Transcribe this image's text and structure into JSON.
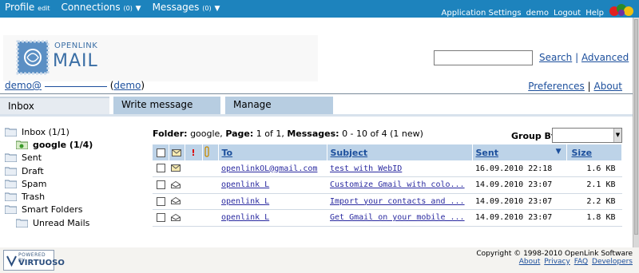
{
  "topbar": {
    "profile": "Profile",
    "edit": "edit",
    "connections": "Connections",
    "connections_count": "(0)",
    "messages": "Messages",
    "messages_count": "(0)",
    "app_settings": "Application Settings",
    "user": "demo",
    "logout": "Logout",
    "help": "Help"
  },
  "logo": {
    "line1": "OPENLINK",
    "line2": "MAIL"
  },
  "search": {
    "value": "",
    "search_link": "Search",
    "advanced_link": "Advanced",
    "separator": "|"
  },
  "account": {
    "email": "demo@",
    "user": "demo"
  },
  "prefs": {
    "preferences": "Preferences",
    "about": "About",
    "separator": "|"
  },
  "tabs": [
    {
      "label": "Inbox"
    },
    {
      "label": "Write message"
    },
    {
      "label": "Manage"
    }
  ],
  "folders": [
    {
      "label": "Inbox (1/1)",
      "sub": false
    },
    {
      "label": "google (1/4)",
      "sub": true,
      "active": true
    },
    {
      "label": "Sent",
      "sub": false
    },
    {
      "label": "Draft",
      "sub": false
    },
    {
      "label": "Spam",
      "sub": false
    },
    {
      "label": "Trash",
      "sub": false
    },
    {
      "label": "Smart Folders",
      "sub": false
    },
    {
      "label": "Unread Mails",
      "sub": true
    }
  ],
  "list": {
    "folder_label": "Folder:",
    "folder_value": "google,",
    "page_label": "Page:",
    "page_value": "1 of 1,",
    "messages_label": "Messages:",
    "messages_value": "0 - 10 of 4 (1 new)",
    "group_by": "Group By",
    "group_by_value": ""
  },
  "table": {
    "headers": {
      "to": "To",
      "subject": "Subject",
      "sent": "Sent",
      "size": "Size",
      "priority": "!"
    },
    "rows": [
      {
        "to": "openlinkOL@gmail.com",
        "subject": "test with WebID",
        "sent": "16.09.2010 22:18",
        "size": "1.6 KB",
        "unread": true
      },
      {
        "to": "openlink L",
        "subject": "Customize Gmail with colo...",
        "sent": "14.09.2010 23:07",
        "size": "2.1 KB",
        "unread": false
      },
      {
        "to": "openlink L",
        "subject": "Import your contacts and ...",
        "sent": "14.09.2010 23:07",
        "size": "2.2 KB",
        "unread": false
      },
      {
        "to": "openlink L",
        "subject": "Get Gmail on your mobile ...",
        "sent": "14.09.2010 23:07",
        "size": "1.8 KB",
        "unread": false
      }
    ]
  },
  "footer": {
    "powered_by": "POWERED BY",
    "virtuoso": "VIRTUOSO",
    "copyright": "Copyright © 1998-2010 OpenLink Software",
    "links": [
      "About",
      "Privacy",
      "FAQ",
      "Developers"
    ]
  },
  "colors": {
    "topbar": "#1d83bd",
    "tab_active": "#e6ebf1",
    "tab_inactive": "#b7cde1",
    "table_header": "#bdd3e8",
    "link": "#1c4f9c"
  }
}
